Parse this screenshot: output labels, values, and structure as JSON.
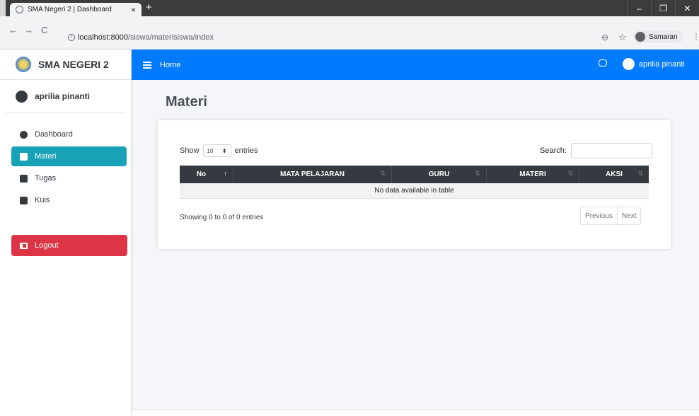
{
  "browser": {
    "tab_title": "SMA Negeri 2 | Dashboard",
    "tab_close": "×",
    "new_tab": "+",
    "url_host": "localhost:8000",
    "url_path": "/siswa/materisiswa/index",
    "profile_label": "Samaran",
    "back": "←",
    "forward": "→",
    "reload": "C",
    "info": "i",
    "win_min": "–",
    "win_restore": "❐",
    "win_close": "✕"
  },
  "sidebar": {
    "brand": "SMA NEGERI 2",
    "user": "aprilia pinanti",
    "items": [
      {
        "label": "Dashboard"
      },
      {
        "label": "Materi"
      },
      {
        "label": "Tugas"
      },
      {
        "label": "Kuis"
      }
    ],
    "logout": "Logout"
  },
  "topnav": {
    "home": "Home",
    "user": "aprilia pinanti"
  },
  "page": {
    "title": "Materi"
  },
  "table": {
    "show_label": "Show",
    "entries_value": "10",
    "entries_label": "entries",
    "search_label": "Search:",
    "columns": [
      "No",
      "MATA PELAJARAN",
      "GURU",
      "MATERI",
      "AKSI"
    ],
    "empty_message": "No data available in table",
    "info": "Showing 0 to 0 of 0 entries",
    "prev": "Previous",
    "next": "Next"
  },
  "colors": {
    "primary": "#007bff",
    "active_nav": "#17a2b8",
    "logout": "#dc3545",
    "table_head": "#343a40"
  }
}
